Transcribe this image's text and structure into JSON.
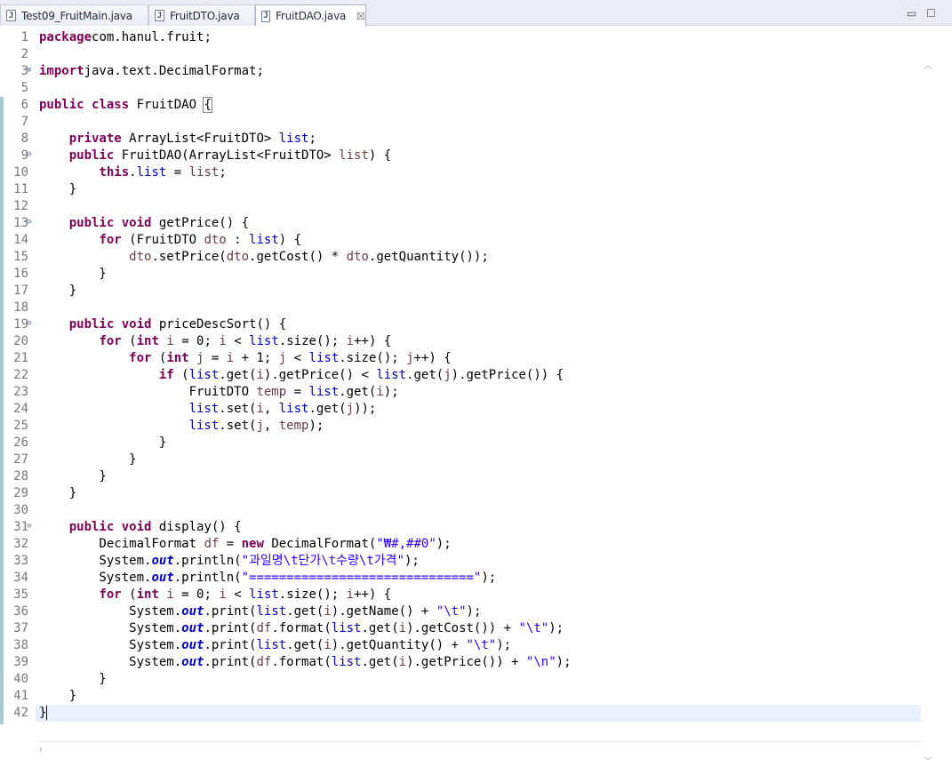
{
  "tabs": [
    {
      "label": "Test09_FruitMain.java",
      "icon": "java-file-icon",
      "active": false
    },
    {
      "label": "FruitDTO.java",
      "icon": "java-file-icon",
      "active": false
    },
    {
      "label": "FruitDAO.java",
      "icon": "java-file-icon",
      "active": true,
      "close": "☒"
    }
  ],
  "window_controls": {
    "minimize": "▭",
    "maximize": "☐"
  },
  "editor": {
    "current_line": 42,
    "lines": [
      {
        "n": "1",
        "s": [
          [
            "kw",
            "package"
          ],
          [
            "",
            "com.hanul.fruit;"
          ]
        ]
      },
      {
        "n": "2",
        "s": []
      },
      {
        "n": "3",
        "fold": "⊕",
        "s": [
          [
            "kw",
            "import"
          ],
          [
            "",
            "java.text.DecimalFormat;"
          ]
        ]
      },
      {
        "n": "5",
        "s": []
      },
      {
        "n": "6",
        "s": [
          [
            "kw",
            "public"
          ],
          [
            "",
            " "
          ],
          [
            "kw",
            "class"
          ],
          [
            "",
            " FruitDAO "
          ],
          [
            "box",
            "{"
          ]
        ]
      },
      {
        "n": "7",
        "s": []
      },
      {
        "n": "8",
        "s": [
          [
            "",
            "    "
          ],
          [
            "kw",
            "private"
          ],
          [
            "",
            " ArrayList<FruitDTO> "
          ],
          [
            "fld",
            "list"
          ],
          [
            "",
            ";"
          ]
        ]
      },
      {
        "n": "9",
        "fold": "⊖",
        "s": [
          [
            "",
            "    "
          ],
          [
            "kw",
            "public"
          ],
          [
            "",
            " FruitDAO(ArrayList<FruitDTO> "
          ],
          [
            "var",
            "list"
          ],
          [
            "",
            ") {"
          ]
        ]
      },
      {
        "n": "10",
        "s": [
          [
            "",
            "        "
          ],
          [
            "kw",
            "this"
          ],
          [
            "",
            "."
          ],
          [
            "fld",
            "list"
          ],
          [
            "",
            " = "
          ],
          [
            "var",
            "list"
          ],
          [
            "",
            ";"
          ]
        ]
      },
      {
        "n": "11",
        "s": [
          [
            "",
            "    }"
          ]
        ]
      },
      {
        "n": "12",
        "s": []
      },
      {
        "n": "13",
        "fold": "⊖",
        "s": [
          [
            "",
            "    "
          ],
          [
            "kw",
            "public"
          ],
          [
            "",
            " "
          ],
          [
            "kw",
            "void"
          ],
          [
            "",
            " getPrice() {"
          ]
        ]
      },
      {
        "n": "14",
        "s": [
          [
            "",
            "        "
          ],
          [
            "kw",
            "for"
          ],
          [
            "",
            " (FruitDTO "
          ],
          [
            "var",
            "dto"
          ],
          [
            "",
            " : "
          ],
          [
            "fld",
            "list"
          ],
          [
            "",
            ") {"
          ]
        ]
      },
      {
        "n": "15",
        "s": [
          [
            "",
            "            "
          ],
          [
            "var",
            "dto"
          ],
          [
            "",
            ".setPrice("
          ],
          [
            "var",
            "dto"
          ],
          [
            "",
            ".getCost() * "
          ],
          [
            "var",
            "dto"
          ],
          [
            "",
            ".getQuantity());"
          ]
        ]
      },
      {
        "n": "16",
        "s": [
          [
            "",
            "        }"
          ]
        ]
      },
      {
        "n": "17",
        "s": [
          [
            "",
            "    }"
          ]
        ]
      },
      {
        "n": "18",
        "s": []
      },
      {
        "n": "19",
        "fold": "⊖",
        "s": [
          [
            "",
            "    "
          ],
          [
            "kw",
            "public"
          ],
          [
            "",
            " "
          ],
          [
            "kw",
            "void"
          ],
          [
            "",
            " priceDescSort() {"
          ]
        ]
      },
      {
        "n": "20",
        "s": [
          [
            "",
            "        "
          ],
          [
            "kw",
            "for"
          ],
          [
            "",
            " ("
          ],
          [
            "kw",
            "int"
          ],
          [
            "",
            " "
          ],
          [
            "var",
            "i"
          ],
          [
            "",
            " = 0; "
          ],
          [
            "var",
            "i"
          ],
          [
            "",
            " < "
          ],
          [
            "fld",
            "list"
          ],
          [
            "",
            ".size(); "
          ],
          [
            "var",
            "i"
          ],
          [
            "",
            "++) {"
          ]
        ]
      },
      {
        "n": "21",
        "s": [
          [
            "",
            "            "
          ],
          [
            "kw",
            "for"
          ],
          [
            "",
            " ("
          ],
          [
            "kw",
            "int"
          ],
          [
            "",
            " "
          ],
          [
            "var",
            "j"
          ],
          [
            "",
            " = "
          ],
          [
            "var",
            "i"
          ],
          [
            "",
            " + 1; "
          ],
          [
            "var",
            "j"
          ],
          [
            "",
            " < "
          ],
          [
            "fld",
            "list"
          ],
          [
            "",
            ".size(); "
          ],
          [
            "var",
            "j"
          ],
          [
            "",
            "++) {"
          ]
        ]
      },
      {
        "n": "22",
        "s": [
          [
            "",
            "                "
          ],
          [
            "kw",
            "if"
          ],
          [
            "",
            " ("
          ],
          [
            "fld",
            "list"
          ],
          [
            "",
            ".get("
          ],
          [
            "var",
            "i"
          ],
          [
            "",
            ").getPrice() < "
          ],
          [
            "fld",
            "list"
          ],
          [
            "",
            ".get("
          ],
          [
            "var",
            "j"
          ],
          [
            "",
            ").getPrice()) {"
          ]
        ]
      },
      {
        "n": "23",
        "s": [
          [
            "",
            "                    FruitDTO "
          ],
          [
            "var",
            "temp"
          ],
          [
            "",
            " = "
          ],
          [
            "fld",
            "list"
          ],
          [
            "",
            ".get("
          ],
          [
            "var",
            "i"
          ],
          [
            "",
            ");"
          ]
        ]
      },
      {
        "n": "24",
        "s": [
          [
            "",
            "                    "
          ],
          [
            "fld",
            "list"
          ],
          [
            "",
            ".set("
          ],
          [
            "var",
            "i"
          ],
          [
            "",
            ", "
          ],
          [
            "fld",
            "list"
          ],
          [
            "",
            ".get("
          ],
          [
            "var",
            "j"
          ],
          [
            "",
            "));"
          ]
        ]
      },
      {
        "n": "25",
        "s": [
          [
            "",
            "                    "
          ],
          [
            "fld",
            "list"
          ],
          [
            "",
            ".set("
          ],
          [
            "var",
            "j"
          ],
          [
            "",
            ", "
          ],
          [
            "var",
            "temp"
          ],
          [
            "",
            ");"
          ]
        ]
      },
      {
        "n": "26",
        "s": [
          [
            "",
            "                }"
          ]
        ]
      },
      {
        "n": "27",
        "s": [
          [
            "",
            "            }"
          ]
        ]
      },
      {
        "n": "28",
        "s": [
          [
            "",
            "        }"
          ]
        ]
      },
      {
        "n": "29",
        "s": [
          [
            "",
            "    }"
          ]
        ]
      },
      {
        "n": "30",
        "s": []
      },
      {
        "n": "31",
        "fold": "⊖",
        "s": [
          [
            "",
            "    "
          ],
          [
            "kw",
            "public"
          ],
          [
            "",
            " "
          ],
          [
            "kw",
            "void"
          ],
          [
            "",
            " display() {"
          ]
        ]
      },
      {
        "n": "32",
        "s": [
          [
            "",
            "        DecimalFormat "
          ],
          [
            "var",
            "df"
          ],
          [
            "",
            " = "
          ],
          [
            "kw",
            "new"
          ],
          [
            "",
            " DecimalFormat("
          ],
          [
            "str",
            "\"₩#,##0\""
          ],
          [
            "",
            ");"
          ]
        ]
      },
      {
        "n": "33",
        "s": [
          [
            "",
            "        System."
          ],
          [
            "sfld",
            "out"
          ],
          [
            "",
            ".println("
          ],
          [
            "str",
            "\"과일명\\t단가\\t수량\\t가격\""
          ],
          [
            "",
            ");"
          ]
        ]
      },
      {
        "n": "34",
        "s": [
          [
            "",
            "        System."
          ],
          [
            "sfld",
            "out"
          ],
          [
            "",
            ".println("
          ],
          [
            "str",
            "\"==============================\""
          ],
          [
            "",
            ");"
          ]
        ]
      },
      {
        "n": "35",
        "s": [
          [
            "",
            "        "
          ],
          [
            "kw",
            "for"
          ],
          [
            "",
            " ("
          ],
          [
            "kw",
            "int"
          ],
          [
            "",
            " "
          ],
          [
            "var",
            "i"
          ],
          [
            "",
            " = 0; "
          ],
          [
            "var",
            "i"
          ],
          [
            "",
            " < "
          ],
          [
            "fld",
            "list"
          ],
          [
            "",
            ".size(); "
          ],
          [
            "var",
            "i"
          ],
          [
            "",
            "++) {"
          ]
        ]
      },
      {
        "n": "36",
        "s": [
          [
            "",
            "            System."
          ],
          [
            "sfld",
            "out"
          ],
          [
            "",
            ".print("
          ],
          [
            "fld",
            "list"
          ],
          [
            "",
            ".get("
          ],
          [
            "var",
            "i"
          ],
          [
            "",
            ").getName() + "
          ],
          [
            "str",
            "\"\\t\""
          ],
          [
            "",
            ");"
          ]
        ]
      },
      {
        "n": "37",
        "s": [
          [
            "",
            "            System."
          ],
          [
            "sfld",
            "out"
          ],
          [
            "",
            ".print("
          ],
          [
            "var",
            "df"
          ],
          [
            "",
            ".format("
          ],
          [
            "fld",
            "list"
          ],
          [
            "",
            ".get("
          ],
          [
            "var",
            "i"
          ],
          [
            "",
            ").getCost()) + "
          ],
          [
            "str",
            "\"\\t\""
          ],
          [
            "",
            ");"
          ]
        ]
      },
      {
        "n": "38",
        "s": [
          [
            "",
            "            System."
          ],
          [
            "sfld",
            "out"
          ],
          [
            "",
            ".print("
          ],
          [
            "fld",
            "list"
          ],
          [
            "",
            ".get("
          ],
          [
            "var",
            "i"
          ],
          [
            "",
            ").getQuantity() + "
          ],
          [
            "str",
            "\"\\t\""
          ],
          [
            "",
            ");"
          ]
        ]
      },
      {
        "n": "39",
        "s": [
          [
            "",
            "            System."
          ],
          [
            "sfld",
            "out"
          ],
          [
            "",
            ".print("
          ],
          [
            "var",
            "df"
          ],
          [
            "",
            ".format("
          ],
          [
            "fld",
            "list"
          ],
          [
            "",
            ".get("
          ],
          [
            "var",
            "i"
          ],
          [
            "",
            ").getPrice()) + "
          ],
          [
            "str",
            "\"\\n\""
          ],
          [
            "",
            ");"
          ]
        ]
      },
      {
        "n": "40",
        "s": [
          [
            "",
            "        }"
          ]
        ]
      },
      {
        "n": "41",
        "s": [
          [
            "",
            "    }"
          ]
        ]
      },
      {
        "n": "42",
        "s": [
          [
            "",
            "}"
          ],
          [
            "caret",
            ""
          ]
        ]
      }
    ]
  }
}
